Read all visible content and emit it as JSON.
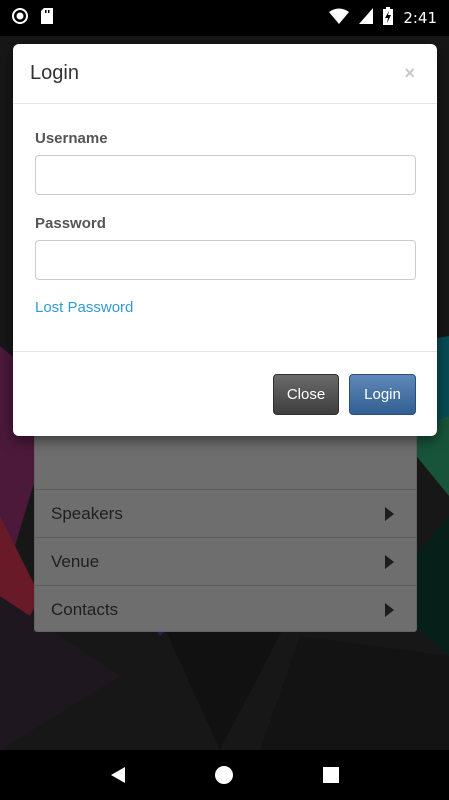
{
  "status_bar": {
    "time": "2:41",
    "icons": [
      "record-icon",
      "sd-card-icon",
      "wifi-icon",
      "signal-icon",
      "battery-charging-icon"
    ]
  },
  "modal": {
    "title": "Login",
    "close_symbol": "×",
    "username_label": "Username",
    "username_value": "",
    "password_label": "Password",
    "password_value": "",
    "lost_password_link": "Lost Password",
    "close_button": "Close",
    "login_button": "Login"
  },
  "background_menu": {
    "items": [
      {
        "label": "Speakers"
      },
      {
        "label": "Venue"
      },
      {
        "label": "Contacts"
      }
    ]
  },
  "nav_bar": {
    "icons": [
      "back-icon",
      "home-icon",
      "recents-icon"
    ]
  },
  "colors": {
    "link": "#3398d8",
    "login_button": "#3a6799",
    "close_button": "#4a4a4a"
  }
}
